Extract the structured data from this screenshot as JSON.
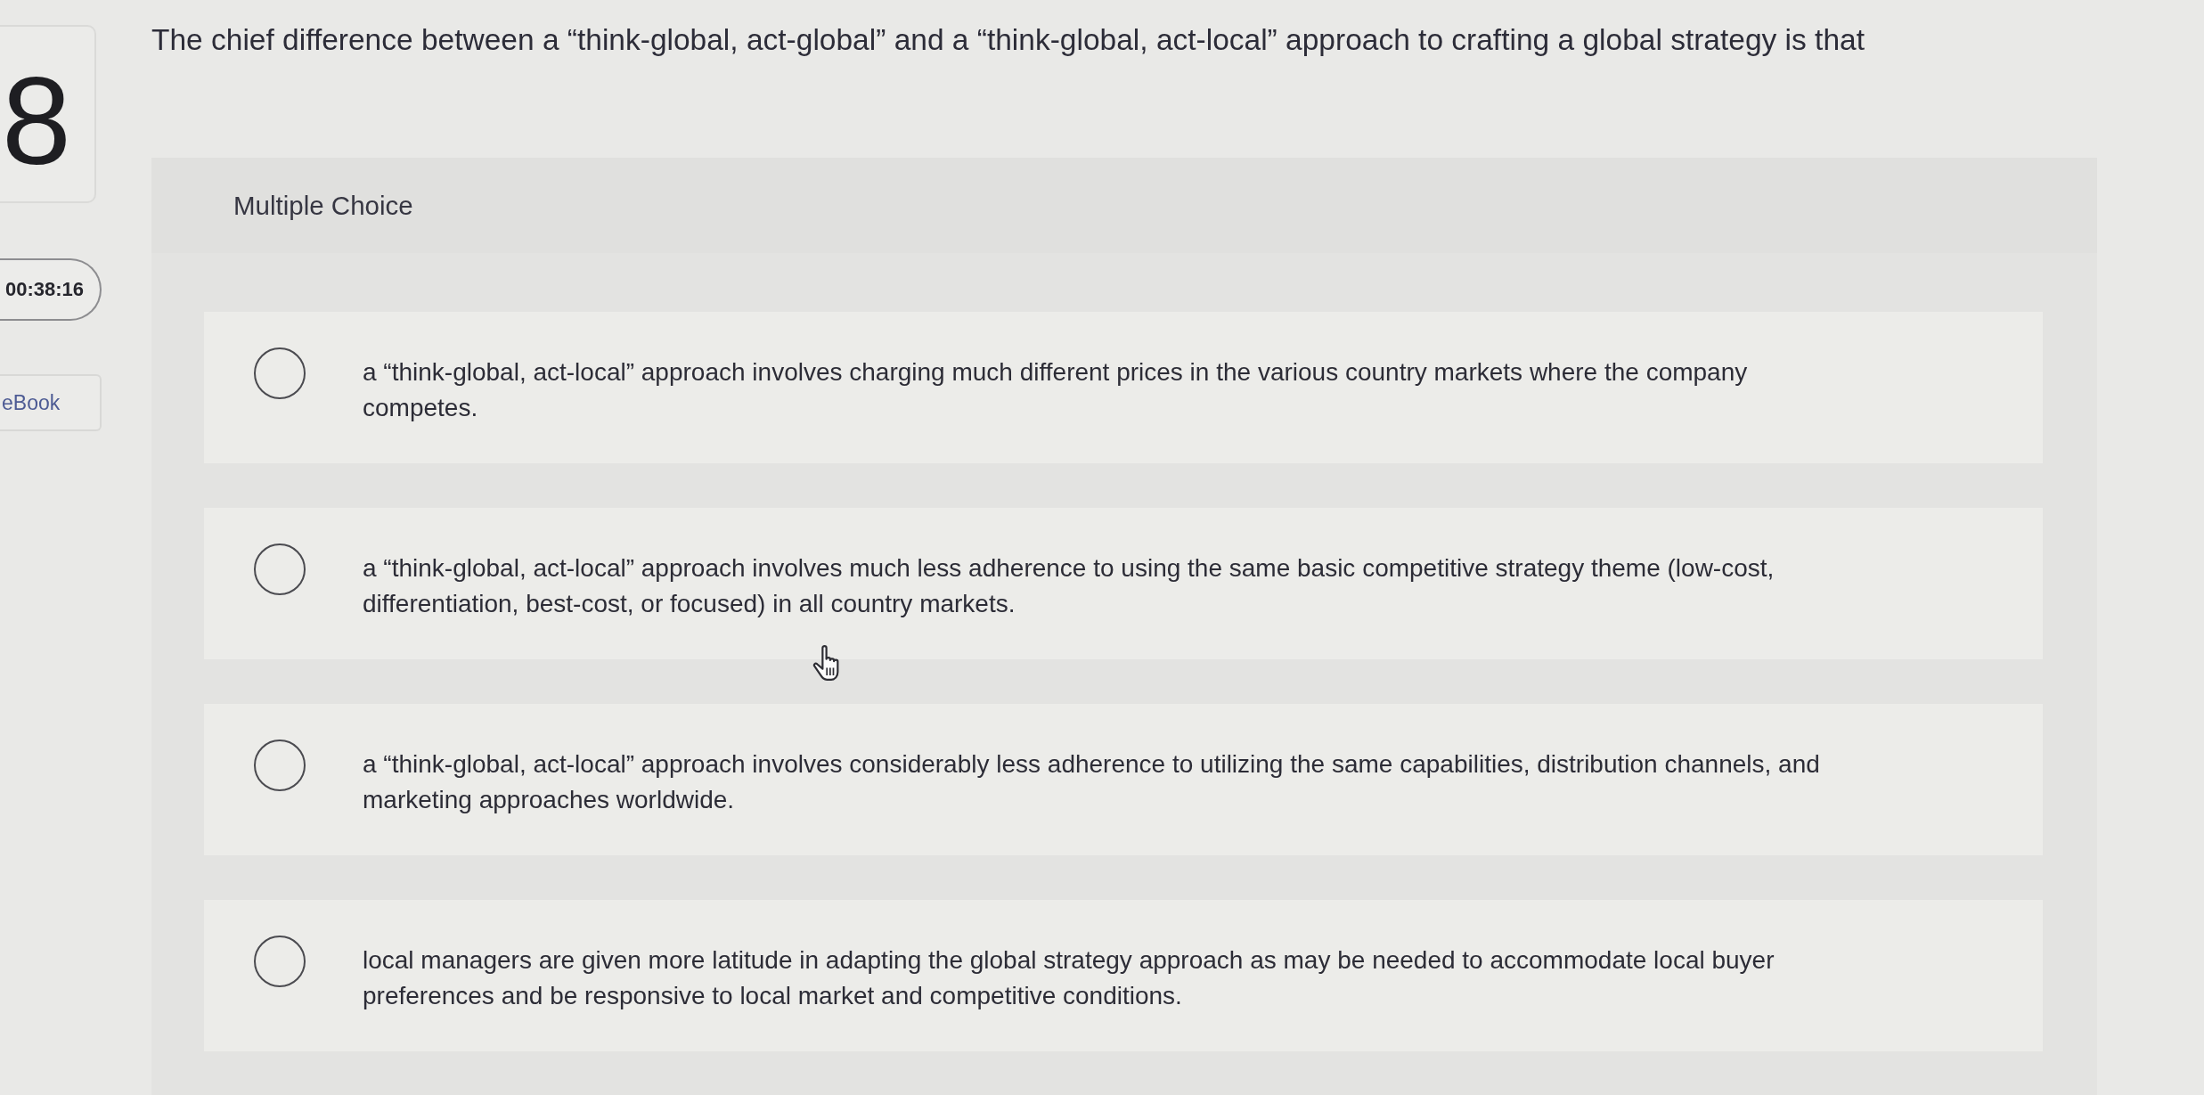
{
  "question_number": "8",
  "timer": "00:38:16",
  "ebook_button": "eBook",
  "question": "The chief difference between a “think-global, act-global” and a “think-global, act-local” approach to crafting a global strategy is that",
  "answer_panel": {
    "type_label": "Multiple Choice",
    "options": [
      {
        "text": "a “think-global, act-local” approach involves charging much different prices in the various country markets where the company competes.",
        "selected": false
      },
      {
        "text": "a “think-global, act-local” approach involves much less adherence to using the same basic competitive strategy theme (low-cost, differentiation, best-cost, or focused) in all country markets.",
        "selected": false
      },
      {
        "text": "a “think-global, act-local” approach involves considerably less adherence to utilizing the same capabilities, distribution channels, and marketing approaches worldwide.",
        "selected": false
      },
      {
        "text": "local managers are given more latitude in adapting the global strategy approach as may be needed to accommodate local buyer preferences and be responsive to local market and competitive conditions.",
        "selected": false
      }
    ]
  }
}
